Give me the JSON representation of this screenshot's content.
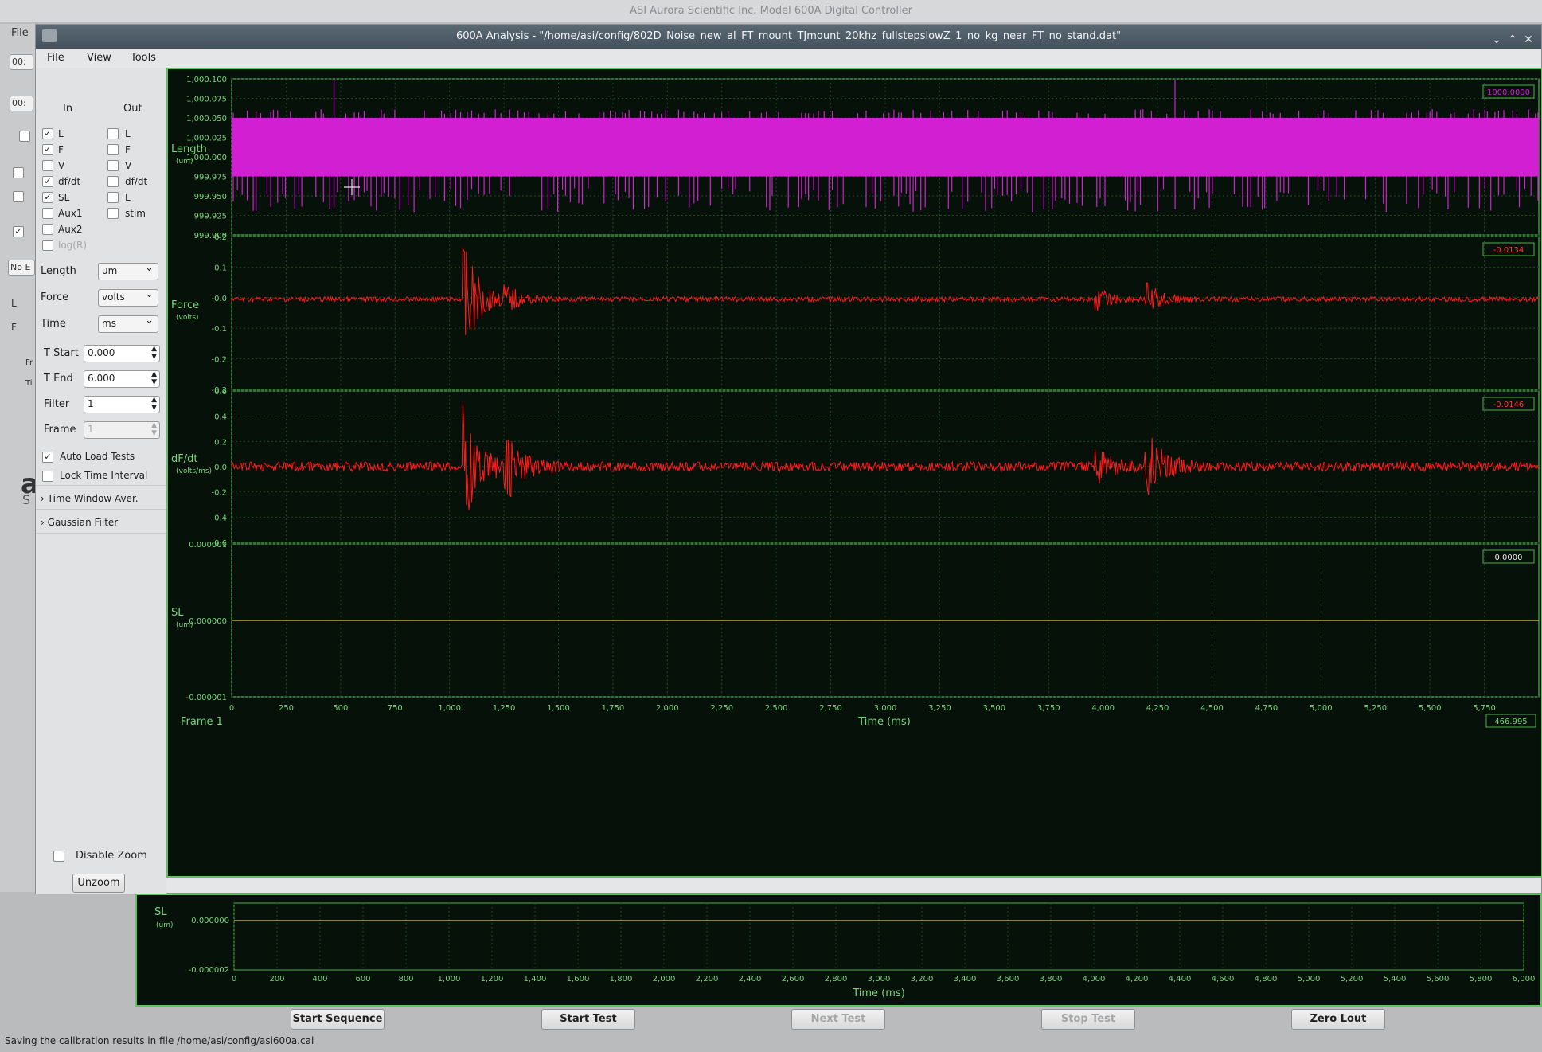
{
  "bg_window": {
    "title": "ASI Aurora Scientific Inc. Model 600A Digital Controller",
    "menu_file": "File",
    "left_fragments": [
      "00:",
      "00:",
      "No E",
      "L",
      "F",
      "Fr",
      "Ti"
    ],
    "logo_a": "a",
    "logo_s": "S",
    "bottom_plot": {
      "channel": "SL",
      "unit": "(um)",
      "y_top": "0.000000",
      "y_bottom": "-0.000002",
      "xlabel": "Time (ms)",
      "x_ticks": [
        "0",
        "200",
        "400",
        "600",
        "800",
        "1,000",
        "1,200",
        "1,400",
        "1,600",
        "1,800",
        "2,000",
        "2,200",
        "2,400",
        "2,600",
        "2,800",
        "3,000",
        "3,200",
        "3,400",
        "3,600",
        "3,800",
        "4,000",
        "4,200",
        "4,400",
        "4,600",
        "4,800",
        "5,000",
        "5,200",
        "5,400",
        "5,600",
        "5,800",
        "6,000"
      ]
    },
    "buttons": [
      "Start Sequence",
      "Start Test",
      "Next Test",
      "Stop Test",
      "Zero Lout"
    ],
    "status": "Saving the calibration results in file /home/asi/config/asi600a.cal"
  },
  "window": {
    "title": "600A Analysis - \"/home/asi/config/802D_Noise_new_al_FT_mount_TJmount_20khz_fullstepslowZ_1_no_kg_near_FT_no_stand.dat\"",
    "menu": [
      "File",
      "View",
      "Tools"
    ]
  },
  "controls": {
    "in_header": "In",
    "out_header": "Out",
    "in_channels": [
      {
        "label": "L",
        "checked": true
      },
      {
        "label": "F",
        "checked": true
      },
      {
        "label": "V",
        "checked": false
      },
      {
        "label": "df/dt",
        "checked": true
      },
      {
        "label": "SL",
        "checked": true
      },
      {
        "label": "Aux1",
        "checked": false
      },
      {
        "label": "Aux2",
        "checked": false
      },
      {
        "label": "log(R)",
        "checked": false
      }
    ],
    "out_channels": [
      {
        "label": "L",
        "checked": false
      },
      {
        "label": "F",
        "checked": false
      },
      {
        "label": "V",
        "checked": false
      },
      {
        "label": "df/dt",
        "checked": false
      },
      {
        "label": "L",
        "checked": false
      },
      {
        "label": "stim",
        "checked": false
      }
    ],
    "units": [
      {
        "label": "Length",
        "value": "um"
      },
      {
        "label": "Force",
        "value": "volts"
      },
      {
        "label": "Time",
        "value": "ms"
      }
    ],
    "spins": [
      {
        "label": "T Start",
        "value": "0.000"
      },
      {
        "label": "T End",
        "value": "6.000"
      },
      {
        "label": "Filter",
        "value": "1"
      },
      {
        "label": "Frame",
        "value": "1"
      }
    ],
    "auto_load": "Auto Load Tests",
    "lock_time": "Lock Time Interval",
    "time_window": "Time Window Aver.",
    "gaussian": "Gaussian Filter",
    "disable_zoom": "Disable Zoom",
    "unzoom": "Unzoom"
  },
  "chart_data": {
    "type": "line",
    "xlabel": "Time (ms)",
    "frame_label": "Frame 1",
    "x_readout": "466.995",
    "x_ticks": [
      "0",
      "250",
      "500",
      "750",
      "1,000",
      "1,250",
      "1,500",
      "1,750",
      "2,000",
      "2,250",
      "2,500",
      "2,750",
      "3,000",
      "3,250",
      "3,500",
      "3,750",
      "4,000",
      "4,250",
      "4,500",
      "4,750",
      "5,000",
      "5,250",
      "5,500",
      "5,750"
    ],
    "xlim": [
      0,
      6000
    ],
    "panels": [
      {
        "name": "Length",
        "unit": "(um)",
        "color": "#d21fd2",
        "readout": "1000.0000",
        "yticks": [
          "1,000.100",
          "1,000.075",
          "1,000.050",
          "1,000.025",
          "1,000.000",
          "999.975",
          "999.950",
          "999.925",
          "999.900"
        ],
        "ylim": [
          999.9,
          1000.1
        ],
        "description_values": {
          "band_min": 999.975,
          "band_max": 1000.05,
          "spike_min": 999.9,
          "spike_max": 1000.1
        }
      },
      {
        "name": "Force",
        "unit": "(volts)",
        "color": "#ff1a1a",
        "readout": "-0.0134",
        "yticks": [
          "0.2",
          "0.1",
          "-0.0",
          "-0.1",
          "-0.2",
          "-0.3"
        ],
        "ylim": [
          -0.3,
          0.2
        ],
        "baseline": -0.005,
        "bursts": [
          {
            "t": 1060,
            "amp": 0.2
          },
          {
            "t": 1250,
            "amp": 0.04
          },
          {
            "t": 3960,
            "amp": 0.04
          },
          {
            "t": 4190,
            "amp": 0.06
          }
        ]
      },
      {
        "name": "dF/dt",
        "unit": "(volts/ms)",
        "color": "#ff1a1a",
        "readout": "-0.0146",
        "yticks": [
          "0.6",
          "0.4",
          "0.2",
          "0.0",
          "-0.2",
          "-0.4",
          "-0.6"
        ],
        "ylim": [
          -0.6,
          0.6
        ],
        "baseline": 0.0,
        "bursts": [
          {
            "t": 1060,
            "amp": 0.5
          },
          {
            "t": 1250,
            "amp": 0.3
          },
          {
            "t": 3960,
            "amp": 0.15
          },
          {
            "t": 4190,
            "amp": 0.35
          }
        ]
      },
      {
        "name": "SL",
        "unit": "(um)",
        "color": "#d8c64a",
        "readout": "0.0000",
        "yticks": [
          "0.000001",
          "0.000000",
          "-0.000001"
        ],
        "ylim": [
          -1e-06,
          1e-06
        ],
        "baseline": 0.0
      }
    ]
  }
}
